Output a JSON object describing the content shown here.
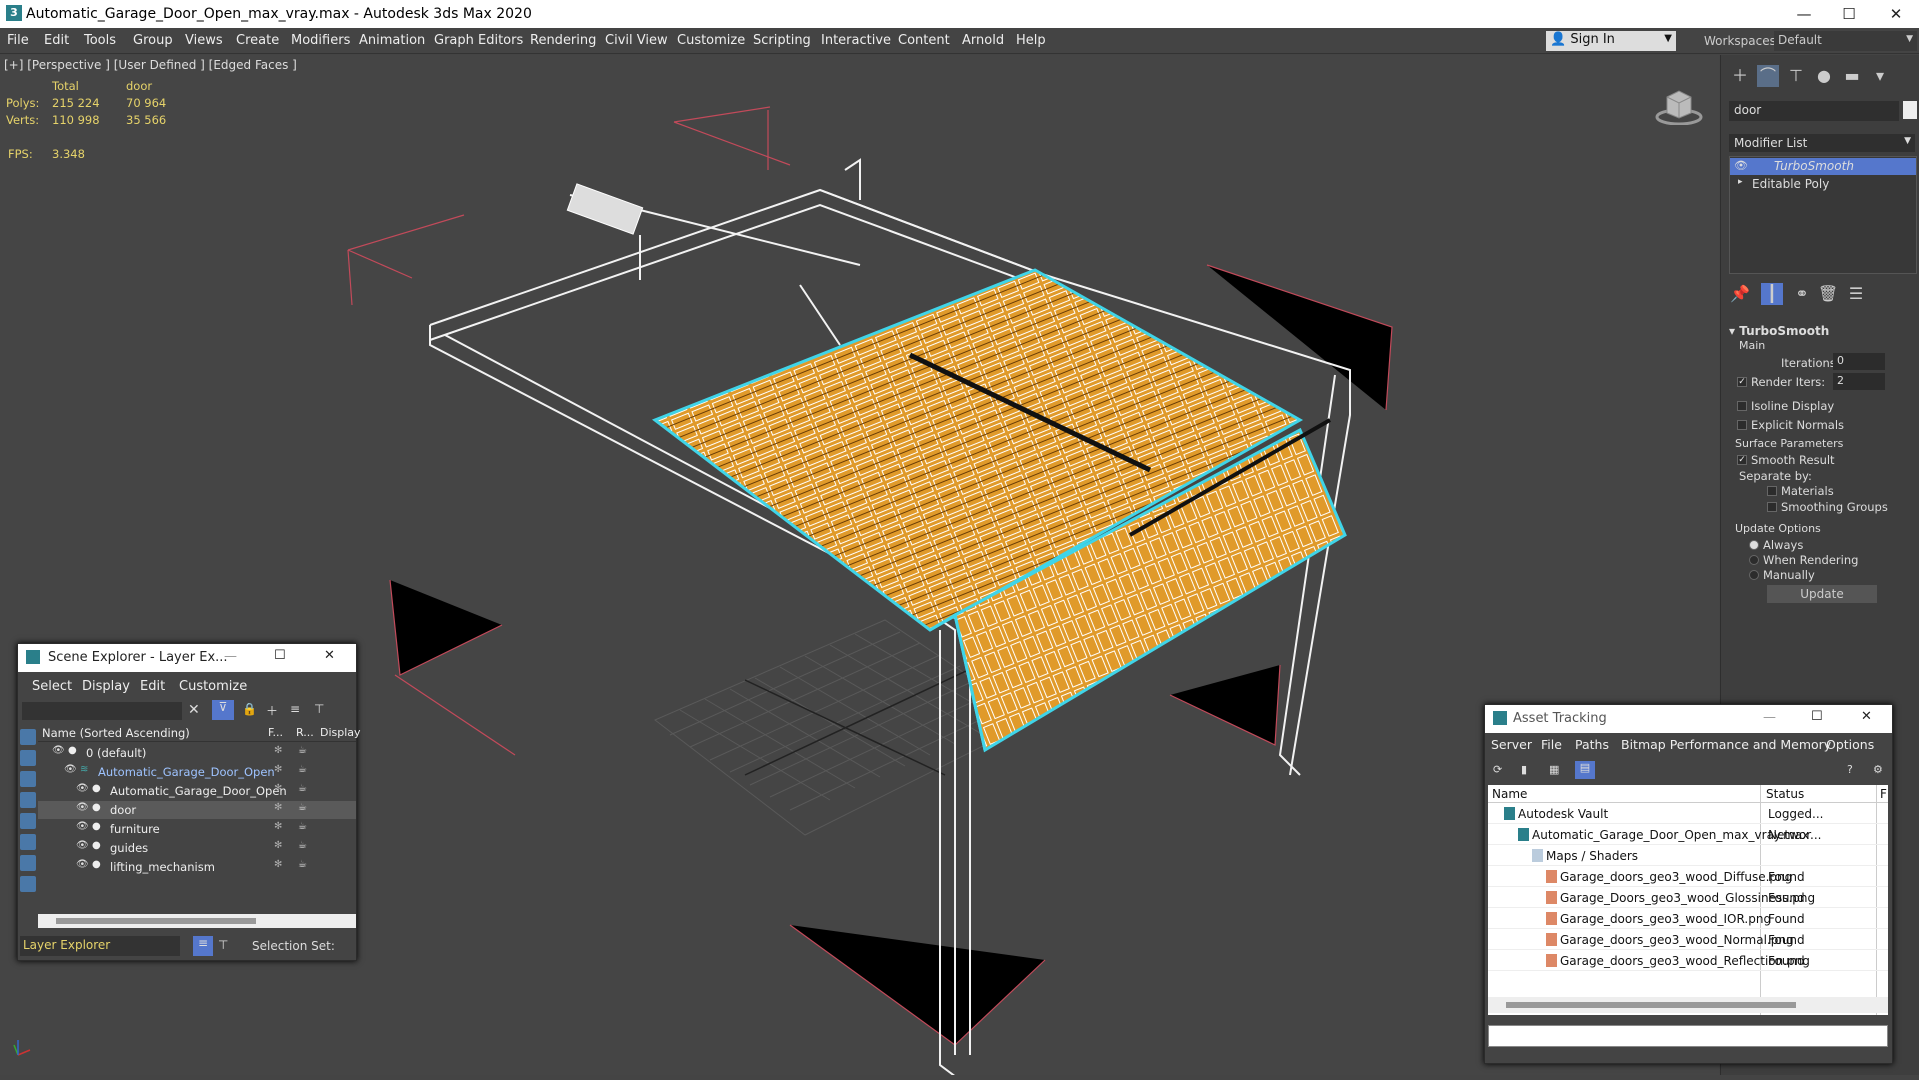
{
  "window": {
    "title": "Automatic_Garage_Door_Open_max_vray.max - Autodesk 3ds Max 2020",
    "minimize": "—",
    "maximize": "☐",
    "close": "✕"
  },
  "menu": [
    "File",
    "Edit",
    "Tools",
    "Group",
    "Views",
    "Create",
    "Modifiers",
    "Animation",
    "Graph Editors",
    "Rendering",
    "Civil View",
    "Customize",
    "Scripting",
    "Interactive",
    "Content",
    "Arnold",
    "Help"
  ],
  "signin": {
    "label": "Sign In"
  },
  "workspace": {
    "label": "Workspaces:",
    "value": "Default"
  },
  "viewport": {
    "label": "[+] [Perspective ] [User Defined ] [Edged Faces ]",
    "stats": {
      "total_label": "Total",
      "sel_label": "door",
      "polys_label": "Polys:",
      "polys_total": "215 224",
      "polys_sel": "70 964",
      "verts_label": "Verts:",
      "verts_total": "110 998",
      "verts_sel": "35 566",
      "fps_label": "FPS:",
      "fps": "3.348"
    }
  },
  "command_panel": {
    "object_name": "door",
    "modifier_list": "Modifier List",
    "stack": [
      "TurboSmooth",
      "Editable Poly"
    ],
    "rollout_title": "TurboSmooth",
    "main": "Main",
    "iterations_label": "Iterations:",
    "iterations": "0",
    "render_iters_label": "Render Iters:",
    "render_iters": "2",
    "isoline": "Isoline Display",
    "explicit": "Explicit Normals",
    "surface_params": "Surface Parameters",
    "smooth_result": "Smooth Result",
    "separate_by": "Separate by:",
    "materials": "Materials",
    "smoothing_groups": "Smoothing Groups",
    "update_options": "Update Options",
    "always": "Always",
    "when_rendering": "When Rendering",
    "manually": "Manually",
    "update_btn": "Update"
  },
  "scene_explorer": {
    "title": "Scene Explorer - Layer Ex...",
    "menu": [
      "Select",
      "Display",
      "Edit",
      "Customize"
    ],
    "col_name": "Name (Sorted Ascending)",
    "col_f": "F...",
    "col_r": "R...",
    "col_display": "Display",
    "rows": [
      {
        "name": "0 (default)",
        "indent": 0
      },
      {
        "name": "Automatic_Garage_Door_Open",
        "indent": 1
      },
      {
        "name": "Automatic_Garage_Door_Open",
        "indent": 2
      },
      {
        "name": "door",
        "indent": 2
      },
      {
        "name": "furniture",
        "indent": 2
      },
      {
        "name": "guides",
        "indent": 2
      },
      {
        "name": "lifting_mechanism",
        "indent": 2
      }
    ],
    "footer_explorer": "Layer Explorer",
    "selection_set": "Selection Set:"
  },
  "asset_tracking": {
    "title": "Asset Tracking",
    "menu": [
      "Server",
      "File",
      "Paths",
      "Bitmap Performance and Memory",
      "Options"
    ],
    "col_name": "Name",
    "col_status": "Status",
    "col_extra": "F",
    "rows": [
      {
        "name": "Autodesk Vault",
        "status": "Logged..."
      },
      {
        "name": "Automatic_Garage_Door_Open_max_vray.max",
        "status": "Networ..."
      },
      {
        "name": "Maps / Shaders",
        "status": ""
      },
      {
        "name": "Garage_doors_geo3_wood_Diffuse.png",
        "status": "Found"
      },
      {
        "name": "Garage_Doors_geo3_wood_Glossiness.png",
        "status": "Found"
      },
      {
        "name": "Garage_doors_geo3_wood_IOR.png",
        "status": "Found"
      },
      {
        "name": "Garage_doors_geo3_wood_Normal.png",
        "status": "Found"
      },
      {
        "name": "Garage_doors_geo3_wood_Reflection.png",
        "status": "Found"
      }
    ]
  },
  "colors": {
    "selection": "#3fd4e8",
    "door_wood": "#e09a2a",
    "bbox": "#c24a5a",
    "stat_text": "#e6d36a",
    "highlight": "#5577cc"
  }
}
